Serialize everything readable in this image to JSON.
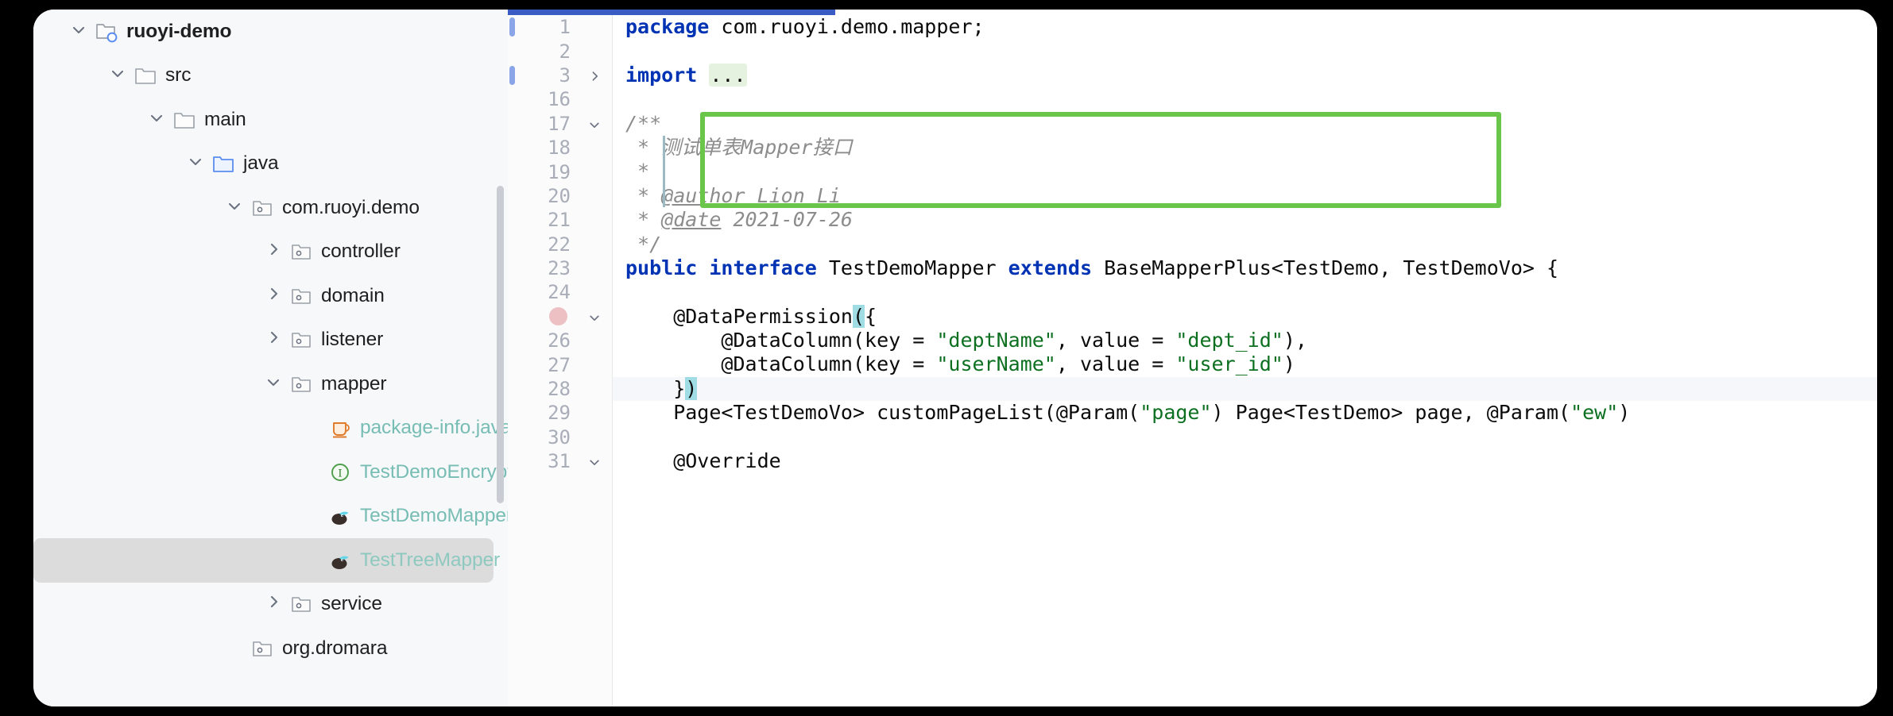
{
  "app": {
    "kind": "java-ide-editor"
  },
  "sidebar": {
    "name": "project-tree",
    "items": [
      {
        "label": "ruoyi-demo",
        "indent": 0,
        "twisty": "chevron-down",
        "icon": "module-folder-icon",
        "bold": true,
        "style": "normal",
        "selected": false
      },
      {
        "label": "src",
        "indent": 1,
        "twisty": "chevron-down",
        "icon": "folder-icon",
        "bold": false,
        "style": "normal",
        "selected": false
      },
      {
        "label": "main",
        "indent": 2,
        "twisty": "chevron-down",
        "icon": "folder-icon",
        "bold": false,
        "style": "normal",
        "selected": false
      },
      {
        "label": "java",
        "indent": 3,
        "twisty": "chevron-down",
        "icon": "source-folder-icon",
        "bold": false,
        "style": "normal",
        "selected": false
      },
      {
        "label": "com.ruoyi.demo",
        "indent": 4,
        "twisty": "chevron-down",
        "icon": "package-icon",
        "bold": false,
        "style": "normal",
        "selected": false
      },
      {
        "label": "controller",
        "indent": 5,
        "twisty": "chevron-right",
        "icon": "package-icon",
        "bold": false,
        "style": "normal",
        "selected": false
      },
      {
        "label": "domain",
        "indent": 5,
        "twisty": "chevron-right",
        "icon": "package-icon",
        "bold": false,
        "style": "normal",
        "selected": false
      },
      {
        "label": "listener",
        "indent": 5,
        "twisty": "chevron-right",
        "icon": "package-icon",
        "bold": false,
        "style": "normal",
        "selected": false
      },
      {
        "label": "mapper",
        "indent": 5,
        "twisty": "chevron-down",
        "icon": "package-icon",
        "bold": false,
        "style": "normal",
        "selected": false
      },
      {
        "label": "package-info.java",
        "indent": 6,
        "twisty": "none",
        "icon": "java-file-icon",
        "bold": false,
        "style": "teal",
        "selected": false
      },
      {
        "label": "TestDemoEncryptMapper",
        "indent": 6,
        "twisty": "none",
        "icon": "interface-icon",
        "bold": false,
        "style": "teal",
        "selected": false
      },
      {
        "label": "TestDemoMapper",
        "indent": 6,
        "twisty": "none",
        "icon": "mybatis-icon",
        "bold": false,
        "style": "teal",
        "selected": false
      },
      {
        "label": "TestTreeMapper",
        "indent": 6,
        "twisty": "none",
        "icon": "mybatis-icon",
        "bold": false,
        "style": "teal-dim",
        "selected": true
      },
      {
        "label": "service",
        "indent": 5,
        "twisty": "chevron-right",
        "icon": "package-icon",
        "bold": false,
        "style": "normal",
        "selected": false
      },
      {
        "label": "org.dromara",
        "indent": 4,
        "twisty": "none",
        "icon": "package-icon",
        "bold": false,
        "style": "normal",
        "selected": false
      }
    ]
  },
  "editor": {
    "name": "code-editor",
    "accent_color": "#3b5bc4",
    "highlight_box_color": "#6ac64b",
    "breakpoint_color": "#edc0c4",
    "vcs_marker_color": "#8aa5e8",
    "gutter": [
      {
        "number": "1",
        "vcs": true,
        "fold": "none",
        "breakpoint": false
      },
      {
        "number": "2",
        "vcs": false,
        "fold": "none",
        "breakpoint": false
      },
      {
        "number": "3",
        "vcs": true,
        "fold": "chevron-right",
        "breakpoint": false
      },
      {
        "number": "16",
        "vcs": false,
        "fold": "none",
        "breakpoint": false
      },
      {
        "number": "17",
        "vcs": false,
        "fold": "chevron-down",
        "breakpoint": false
      },
      {
        "number": "18",
        "vcs": false,
        "fold": "none",
        "breakpoint": false
      },
      {
        "number": "19",
        "vcs": false,
        "fold": "none",
        "breakpoint": false
      },
      {
        "number": "20",
        "vcs": false,
        "fold": "none",
        "breakpoint": false
      },
      {
        "number": "21",
        "vcs": false,
        "fold": "none",
        "breakpoint": false
      },
      {
        "number": "22",
        "vcs": false,
        "fold": "none",
        "breakpoint": false
      },
      {
        "number": "23",
        "vcs": false,
        "fold": "none",
        "breakpoint": false
      },
      {
        "number": "24",
        "vcs": false,
        "fold": "none",
        "breakpoint": false
      },
      {
        "number": "25",
        "vcs": false,
        "fold": "chevron-down",
        "breakpoint": true
      },
      {
        "number": "26",
        "vcs": false,
        "fold": "none",
        "breakpoint": false
      },
      {
        "number": "27",
        "vcs": false,
        "fold": "none",
        "breakpoint": false
      },
      {
        "number": "28",
        "vcs": false,
        "fold": "none",
        "breakpoint": false
      },
      {
        "number": "29",
        "vcs": false,
        "fold": "none",
        "breakpoint": false
      },
      {
        "number": "30",
        "vcs": false,
        "fold": "none",
        "breakpoint": false
      },
      {
        "number": "31",
        "vcs": false,
        "fold": "chevron-down",
        "breakpoint": false
      }
    ],
    "code_lines": [
      {
        "line": "1",
        "tokens": [
          {
            "t": "package ",
            "c": "kw"
          },
          {
            "t": "com.ruoyi.demo.mapper;",
            "c": "plain"
          }
        ]
      },
      {
        "line": "2",
        "tokens": []
      },
      {
        "line": "3",
        "tokens": [
          {
            "t": "import ",
            "c": "kw"
          },
          {
            "t": "...",
            "c": "fold-placeholder"
          }
        ]
      },
      {
        "line": "16",
        "tokens": []
      },
      {
        "line": "17",
        "tokens": [
          {
            "t": "/**",
            "c": "cmt"
          }
        ]
      },
      {
        "line": "18",
        "tokens": [
          {
            "t": " * 测试单表Mapper接口",
            "c": "cmt"
          }
        ]
      },
      {
        "line": "19",
        "tokens": [
          {
            "t": " *",
            "c": "cmt"
          }
        ]
      },
      {
        "line": "20",
        "tokens": [
          {
            "t": " * ",
            "c": "cmt"
          },
          {
            "t": "@author",
            "c": "tag"
          },
          {
            "t": " Lion Li",
            "c": "cmt"
          }
        ]
      },
      {
        "line": "21",
        "tokens": [
          {
            "t": " * ",
            "c": "cmt"
          },
          {
            "t": "@date",
            "c": "tag"
          },
          {
            "t": " 2021-07-26",
            "c": "cmt"
          }
        ]
      },
      {
        "line": "22",
        "tokens": [
          {
            "t": " */",
            "c": "cmt"
          }
        ]
      },
      {
        "line": "23",
        "tokens": [
          {
            "t": "public interface ",
            "c": "kw"
          },
          {
            "t": "TestDemoMapper ",
            "c": "plain"
          },
          {
            "t": "extends ",
            "c": "kw"
          },
          {
            "t": "BaseMapperPlus<TestDemo, TestDemoVo> {",
            "c": "plain"
          }
        ]
      },
      {
        "line": "24",
        "tokens": []
      },
      {
        "line": "25",
        "tokens": [
          {
            "t": "    @DataPermission",
            "c": "plain"
          },
          {
            "t": "(",
            "c": "brmatch"
          },
          {
            "t": "{",
            "c": "plain"
          }
        ]
      },
      {
        "line": "26",
        "tokens": [
          {
            "t": "        @DataColumn(key = ",
            "c": "plain"
          },
          {
            "t": "\"deptName\"",
            "c": "str"
          },
          {
            "t": ", value = ",
            "c": "plain"
          },
          {
            "t": "\"dept_id\"",
            "c": "str"
          },
          {
            "t": "),",
            "c": "plain"
          }
        ]
      },
      {
        "line": "27",
        "tokens": [
          {
            "t": "        @DataColumn(key = ",
            "c": "plain"
          },
          {
            "t": "\"userName\"",
            "c": "str"
          },
          {
            "t": ", value = ",
            "c": "plain"
          },
          {
            "t": "\"user_id\"",
            "c": "str"
          },
          {
            "t": ")",
            "c": "plain"
          }
        ]
      },
      {
        "line": "28",
        "tokens": [
          {
            "t": "    }",
            "c": "plain"
          },
          {
            "t": ")",
            "c": "brmatch"
          }
        ]
      },
      {
        "line": "29",
        "tokens": [
          {
            "t": "    Page<TestDemoVo> customPageList(@Param(",
            "c": "plain"
          },
          {
            "t": "\"page\"",
            "c": "str"
          },
          {
            "t": ") Page<TestDemo> page, @Param(",
            "c": "plain"
          },
          {
            "t": "\"ew\"",
            "c": "str"
          },
          {
            "t": ")",
            "c": "plain"
          }
        ]
      },
      {
        "line": "30",
        "tokens": []
      },
      {
        "line": "31",
        "tokens": [
          {
            "t": "    @Override",
            "c": "plain"
          }
        ]
      }
    ]
  }
}
